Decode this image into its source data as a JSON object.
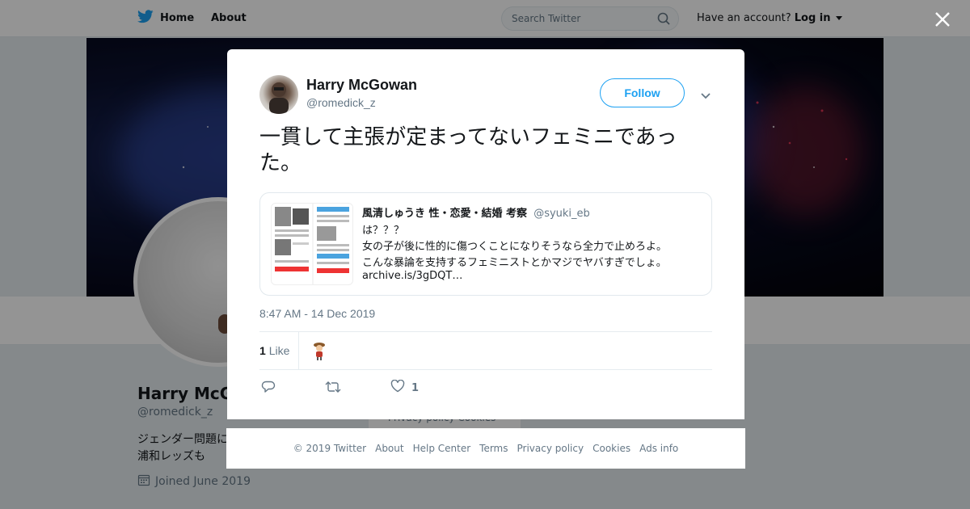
{
  "topbar": {
    "home_label": "Home",
    "about_label": "About",
    "search_placeholder": "Search Twitter",
    "account_prompt": "Have an account?",
    "login_label": "Log in"
  },
  "profile": {
    "name": "Harry McGowan",
    "name_visible": "Harry McG",
    "handle": "@romedick_z",
    "bio_line1": "ジェンダー問題に",
    "bio_line2": "浦和レッズも",
    "joined": "Joined June 2019",
    "privacy_cookies": "Privacy policy   Cookies"
  },
  "tweet": {
    "author_name": "Harry McGowan",
    "author_handle": "@romedick_z",
    "follow_label": "Follow",
    "text": "一貫して主張が定まってないフェミニであった。",
    "quoted": {
      "name": "風清しゅうき 性・恋愛・結婚 考察",
      "handle": "@syuki_eb",
      "lines": [
        "は？？？",
        "女の子が後に性的に傷つくことになりそうなら全力で止めろよ。",
        "こんな暴論を支持するフェミニストとかマジでヤバすぎでしょ。",
        "archive.is/3gDQT…"
      ]
    },
    "timestamp": "8:47 AM - 14 Dec 2019",
    "likes_count": "1",
    "likes_label": "Like",
    "like_action_count": "1"
  },
  "footer": {
    "links": [
      "© 2019 Twitter",
      "About",
      "Help Center",
      "Terms",
      "Privacy policy",
      "Cookies",
      "Ads info"
    ]
  },
  "colors": {
    "accent": "#1da1f2",
    "secondary_text": "#657786",
    "primary_text": "#14171a"
  },
  "icons": [
    "twitter-bird-icon",
    "search-icon",
    "caret-down-icon",
    "close-icon",
    "chevron-down-icon",
    "reply-icon",
    "retweet-icon",
    "heart-icon",
    "calendar-icon"
  ]
}
